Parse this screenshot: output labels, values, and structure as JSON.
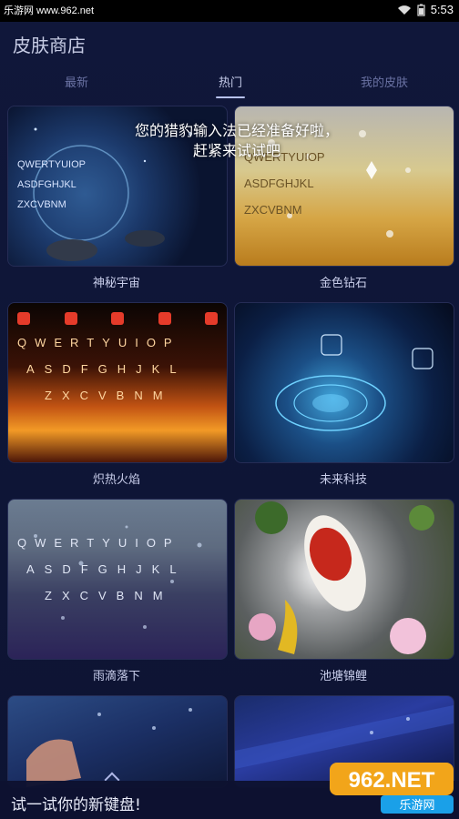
{
  "status_bar": {
    "watermark": "乐游网 www.962.net",
    "time": "5:53"
  },
  "header": {
    "title": "皮肤商店"
  },
  "tabs": [
    {
      "label": "最新"
    },
    {
      "label": "热门"
    },
    {
      "label": "我的皮肤"
    }
  ],
  "toast": {
    "line1": "您的猎豹输入法已经准备好啦，",
    "line2": "赶紧来试试吧"
  },
  "skins": [
    {
      "name": "神秘宇宙"
    },
    {
      "name": "金色钻石"
    },
    {
      "name": "炽热火焰"
    },
    {
      "name": "未来科技"
    },
    {
      "name": "雨滴落下"
    },
    {
      "name": "池塘锦鲤"
    },
    {
      "name": ""
    },
    {
      "name": ""
    }
  ],
  "keyboard": {
    "row1": "QWERTYUIOP",
    "row2": "ASDFGHJKL",
    "row3": "ZXCVBNM"
  },
  "bottom_bar": {
    "prompt": "试一试你的新键盘!"
  },
  "logo": {
    "brand": "962.NET",
    "sub": "乐游网"
  },
  "colors": {
    "accent": "#b8c2f0",
    "background": "#0f1536",
    "tab_inactive": "#6a72a3"
  }
}
